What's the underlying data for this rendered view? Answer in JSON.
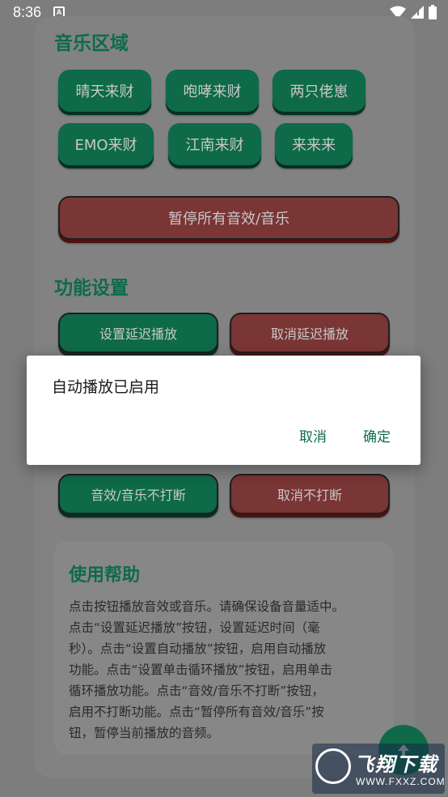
{
  "status_bar": {
    "time": "8:36",
    "notif_label": "A"
  },
  "music": {
    "title": "音乐区域",
    "buttons": [
      "晴天来财",
      "咆哮来财",
      "两只佬崽",
      "EMO来财",
      "江南来财",
      "来来来"
    ],
    "stop_all": "暂停所有音效/音乐"
  },
  "settings": {
    "title": "功能设置",
    "set_delay": "设置延迟播放",
    "cancel_delay": "取消延迟播放",
    "no_interrupt": "音效/音乐不打断",
    "cancel_no_interrupt": "取消不打断"
  },
  "help": {
    "title": "使用帮助",
    "lines": [
      "点击按钮播放音效或音乐。请确保设备音量适中。",
      "点击“设置延迟播放”按钮，设置延迟时间（毫",
      "秒）。点击“设置自动播放”按钮，启用自动播放",
      "功能。点击“设置单击循环播放”按钮，启用单击",
      "循环播放功能。点击“音效/音乐不打断”按钮，",
      "启用不打断功能。点击“暂停所有音效/音乐”按",
      "钮，暂停当前播放的音频。"
    ]
  },
  "dialog": {
    "message": "自动播放已启用",
    "cancel": "取消",
    "confirm": "确定"
  },
  "watermark": {
    "text": "飞翔下载",
    "url": "WWW.FXXZ.COM"
  },
  "colors": {
    "accent": "#0d6b4c",
    "green_button": "#0e6a48",
    "red_button": "#7a3535"
  }
}
